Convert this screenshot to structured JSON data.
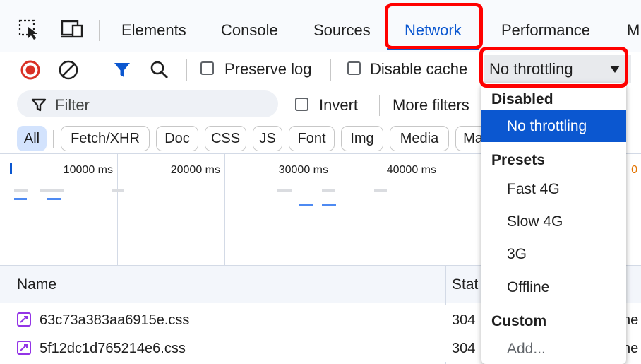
{
  "tabs": {
    "elements": "Elements",
    "console": "Console",
    "sources": "Sources",
    "network": "Network",
    "performance": "Performance",
    "memory_fragment": "M"
  },
  "toolbar": {
    "preserve_log": "Preserve log",
    "disable_cache": "Disable cache",
    "throttling_value": "No throttling"
  },
  "filter": {
    "placeholder": "Filter",
    "invert": "Invert",
    "more_filters": "More filters"
  },
  "type_chips": [
    "All",
    "Fetch/XHR",
    "Doc",
    "CSS",
    "JS",
    "Font",
    "Img",
    "Media",
    "Ma"
  ],
  "overview": {
    "ticks": [
      "10000 ms",
      "20000 ms",
      "30000 ms",
      "40000 ms"
    ],
    "right_tick_fragment": "0"
  },
  "table": {
    "columns": {
      "name": "Name",
      "status": "Stat"
    },
    "rows": [
      {
        "name": "63c73a383aa6915e.css",
        "status": "304",
        "fragment": "he"
      },
      {
        "name": "5f12dc1d765214e6.css",
        "status": "304",
        "fragment": "he"
      }
    ]
  },
  "throttle_menu": {
    "groups": [
      {
        "label": "Disabled",
        "items": [
          "No throttling"
        ]
      },
      {
        "label": "Presets",
        "items": [
          "Fast 4G",
          "Slow 4G",
          "3G",
          "Offline"
        ]
      },
      {
        "label": "Custom",
        "items": [
          "Add..."
        ]
      }
    ],
    "selected": "No throttling"
  },
  "colors": {
    "accent": "#0b57d0",
    "record_red": "#d93025",
    "highlight": "#ff0000",
    "css_file_icon": "#9334e6"
  }
}
